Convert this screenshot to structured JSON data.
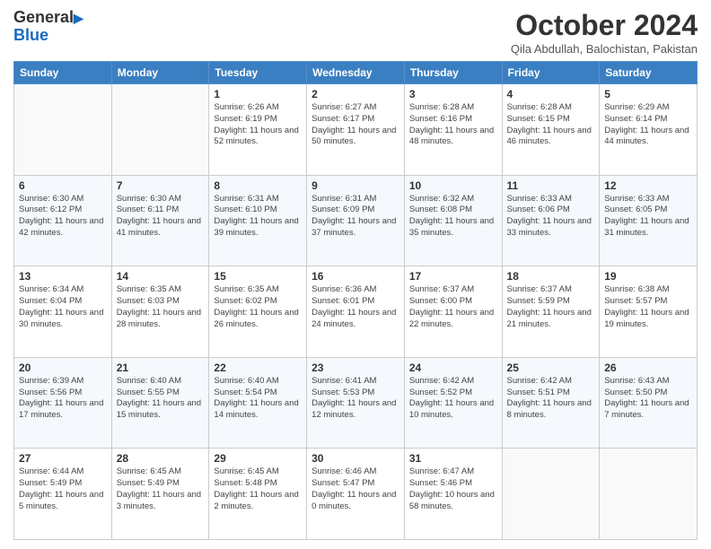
{
  "logo": {
    "line1": "General",
    "line2": "Blue"
  },
  "header": {
    "month": "October 2024",
    "location": "Qila Abdullah, Balochistan, Pakistan"
  },
  "days_of_week": [
    "Sunday",
    "Monday",
    "Tuesday",
    "Wednesday",
    "Thursday",
    "Friday",
    "Saturday"
  ],
  "weeks": [
    [
      {
        "day": "",
        "sunrise": "",
        "sunset": "",
        "daylight": ""
      },
      {
        "day": "",
        "sunrise": "",
        "sunset": "",
        "daylight": ""
      },
      {
        "day": "1",
        "sunrise": "Sunrise: 6:26 AM",
        "sunset": "Sunset: 6:19 PM",
        "daylight": "Daylight: 11 hours and 52 minutes."
      },
      {
        "day": "2",
        "sunrise": "Sunrise: 6:27 AM",
        "sunset": "Sunset: 6:17 PM",
        "daylight": "Daylight: 11 hours and 50 minutes."
      },
      {
        "day": "3",
        "sunrise": "Sunrise: 6:28 AM",
        "sunset": "Sunset: 6:16 PM",
        "daylight": "Daylight: 11 hours and 48 minutes."
      },
      {
        "day": "4",
        "sunrise": "Sunrise: 6:28 AM",
        "sunset": "Sunset: 6:15 PM",
        "daylight": "Daylight: 11 hours and 46 minutes."
      },
      {
        "day": "5",
        "sunrise": "Sunrise: 6:29 AM",
        "sunset": "Sunset: 6:14 PM",
        "daylight": "Daylight: 11 hours and 44 minutes."
      }
    ],
    [
      {
        "day": "6",
        "sunrise": "Sunrise: 6:30 AM",
        "sunset": "Sunset: 6:12 PM",
        "daylight": "Daylight: 11 hours and 42 minutes."
      },
      {
        "day": "7",
        "sunrise": "Sunrise: 6:30 AM",
        "sunset": "Sunset: 6:11 PM",
        "daylight": "Daylight: 11 hours and 41 minutes."
      },
      {
        "day": "8",
        "sunrise": "Sunrise: 6:31 AM",
        "sunset": "Sunset: 6:10 PM",
        "daylight": "Daylight: 11 hours and 39 minutes."
      },
      {
        "day": "9",
        "sunrise": "Sunrise: 6:31 AM",
        "sunset": "Sunset: 6:09 PM",
        "daylight": "Daylight: 11 hours and 37 minutes."
      },
      {
        "day": "10",
        "sunrise": "Sunrise: 6:32 AM",
        "sunset": "Sunset: 6:08 PM",
        "daylight": "Daylight: 11 hours and 35 minutes."
      },
      {
        "day": "11",
        "sunrise": "Sunrise: 6:33 AM",
        "sunset": "Sunset: 6:06 PM",
        "daylight": "Daylight: 11 hours and 33 minutes."
      },
      {
        "day": "12",
        "sunrise": "Sunrise: 6:33 AM",
        "sunset": "Sunset: 6:05 PM",
        "daylight": "Daylight: 11 hours and 31 minutes."
      }
    ],
    [
      {
        "day": "13",
        "sunrise": "Sunrise: 6:34 AM",
        "sunset": "Sunset: 6:04 PM",
        "daylight": "Daylight: 11 hours and 30 minutes."
      },
      {
        "day": "14",
        "sunrise": "Sunrise: 6:35 AM",
        "sunset": "Sunset: 6:03 PM",
        "daylight": "Daylight: 11 hours and 28 minutes."
      },
      {
        "day": "15",
        "sunrise": "Sunrise: 6:35 AM",
        "sunset": "Sunset: 6:02 PM",
        "daylight": "Daylight: 11 hours and 26 minutes."
      },
      {
        "day": "16",
        "sunrise": "Sunrise: 6:36 AM",
        "sunset": "Sunset: 6:01 PM",
        "daylight": "Daylight: 11 hours and 24 minutes."
      },
      {
        "day": "17",
        "sunrise": "Sunrise: 6:37 AM",
        "sunset": "Sunset: 6:00 PM",
        "daylight": "Daylight: 11 hours and 22 minutes."
      },
      {
        "day": "18",
        "sunrise": "Sunrise: 6:37 AM",
        "sunset": "Sunset: 5:59 PM",
        "daylight": "Daylight: 11 hours and 21 minutes."
      },
      {
        "day": "19",
        "sunrise": "Sunrise: 6:38 AM",
        "sunset": "Sunset: 5:57 PM",
        "daylight": "Daylight: 11 hours and 19 minutes."
      }
    ],
    [
      {
        "day": "20",
        "sunrise": "Sunrise: 6:39 AM",
        "sunset": "Sunset: 5:56 PM",
        "daylight": "Daylight: 11 hours and 17 minutes."
      },
      {
        "day": "21",
        "sunrise": "Sunrise: 6:40 AM",
        "sunset": "Sunset: 5:55 PM",
        "daylight": "Daylight: 11 hours and 15 minutes."
      },
      {
        "day": "22",
        "sunrise": "Sunrise: 6:40 AM",
        "sunset": "Sunset: 5:54 PM",
        "daylight": "Daylight: 11 hours and 14 minutes."
      },
      {
        "day": "23",
        "sunrise": "Sunrise: 6:41 AM",
        "sunset": "Sunset: 5:53 PM",
        "daylight": "Daylight: 11 hours and 12 minutes."
      },
      {
        "day": "24",
        "sunrise": "Sunrise: 6:42 AM",
        "sunset": "Sunset: 5:52 PM",
        "daylight": "Daylight: 11 hours and 10 minutes."
      },
      {
        "day": "25",
        "sunrise": "Sunrise: 6:42 AM",
        "sunset": "Sunset: 5:51 PM",
        "daylight": "Daylight: 11 hours and 8 minutes."
      },
      {
        "day": "26",
        "sunrise": "Sunrise: 6:43 AM",
        "sunset": "Sunset: 5:50 PM",
        "daylight": "Daylight: 11 hours and 7 minutes."
      }
    ],
    [
      {
        "day": "27",
        "sunrise": "Sunrise: 6:44 AM",
        "sunset": "Sunset: 5:49 PM",
        "daylight": "Daylight: 11 hours and 5 minutes."
      },
      {
        "day": "28",
        "sunrise": "Sunrise: 6:45 AM",
        "sunset": "Sunset: 5:49 PM",
        "daylight": "Daylight: 11 hours and 3 minutes."
      },
      {
        "day": "29",
        "sunrise": "Sunrise: 6:45 AM",
        "sunset": "Sunset: 5:48 PM",
        "daylight": "Daylight: 11 hours and 2 minutes."
      },
      {
        "day": "30",
        "sunrise": "Sunrise: 6:46 AM",
        "sunset": "Sunset: 5:47 PM",
        "daylight": "Daylight: 11 hours and 0 minutes."
      },
      {
        "day": "31",
        "sunrise": "Sunrise: 6:47 AM",
        "sunset": "Sunset: 5:46 PM",
        "daylight": "Daylight: 10 hours and 58 minutes."
      },
      {
        "day": "",
        "sunrise": "",
        "sunset": "",
        "daylight": ""
      },
      {
        "day": "",
        "sunrise": "",
        "sunset": "",
        "daylight": ""
      }
    ]
  ]
}
